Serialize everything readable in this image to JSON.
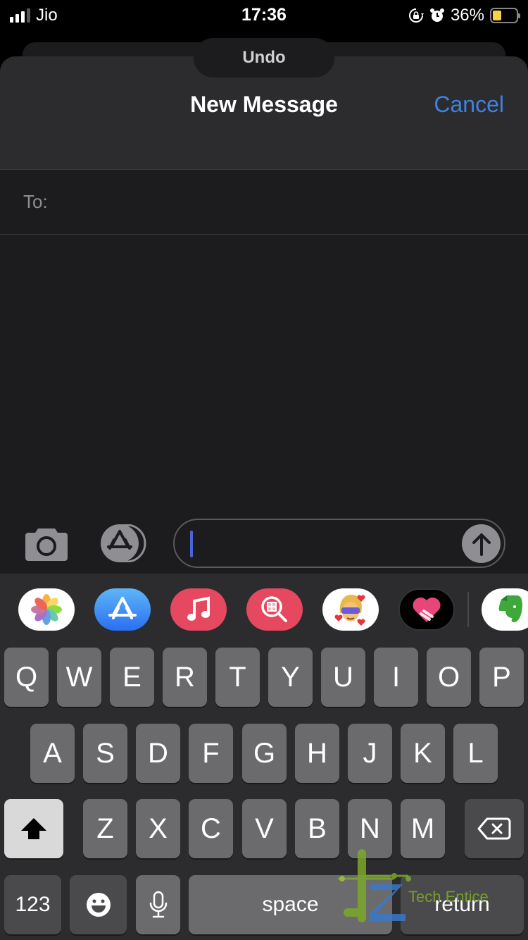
{
  "status_bar": {
    "carrier": "Jio",
    "signal_bars_active": 3,
    "signal_bars_total": 4,
    "time": "17:36",
    "icons": [
      "orientation-lock-icon",
      "alarm-icon"
    ],
    "battery_percent_label": "36%",
    "battery_level": 0.36,
    "battery_color": "#f7d147"
  },
  "undo": {
    "label": "Undo"
  },
  "sheet": {
    "title": "New Message",
    "cancel_label": "Cancel",
    "accent_color": "#3e82e5"
  },
  "to_field": {
    "label": "To:",
    "value": "",
    "placeholder": ""
  },
  "compose": {
    "message_value": "",
    "placeholder": "",
    "camera_icon": "camera-icon",
    "apps_icon": "app-store-icon",
    "send_icon": "arrow-up-icon"
  },
  "app_drawer": {
    "apps": [
      {
        "name": "Photos",
        "icon": "photos-icon"
      },
      {
        "name": "App Store",
        "icon": "app-store-icon"
      },
      {
        "name": "Music",
        "icon": "music-icon"
      },
      {
        "name": "Web Images",
        "icon": "image-search-icon"
      },
      {
        "name": "Memoji",
        "icon": "memoji-icon"
      },
      {
        "name": "Digital Touch",
        "icon": "digital-touch-icon"
      },
      {
        "name": "Evernote",
        "icon": "evernote-icon"
      }
    ]
  },
  "keyboard": {
    "row1": [
      "Q",
      "W",
      "E",
      "R",
      "T",
      "Y",
      "U",
      "I",
      "O",
      "P"
    ],
    "row2": [
      "A",
      "S",
      "D",
      "F",
      "G",
      "H",
      "J",
      "K",
      "L"
    ],
    "row3": [
      "Z",
      "X",
      "C",
      "V",
      "B",
      "N",
      "M"
    ],
    "numbers_label": "123",
    "space_label": "space",
    "return_label": "return",
    "shift_icon": "shift-icon",
    "delete_icon": "delete-icon",
    "emoji_icon": "emoji-icon",
    "mic_icon": "microphone-icon"
  },
  "watermark": {
    "text": "Tech Entice"
  }
}
